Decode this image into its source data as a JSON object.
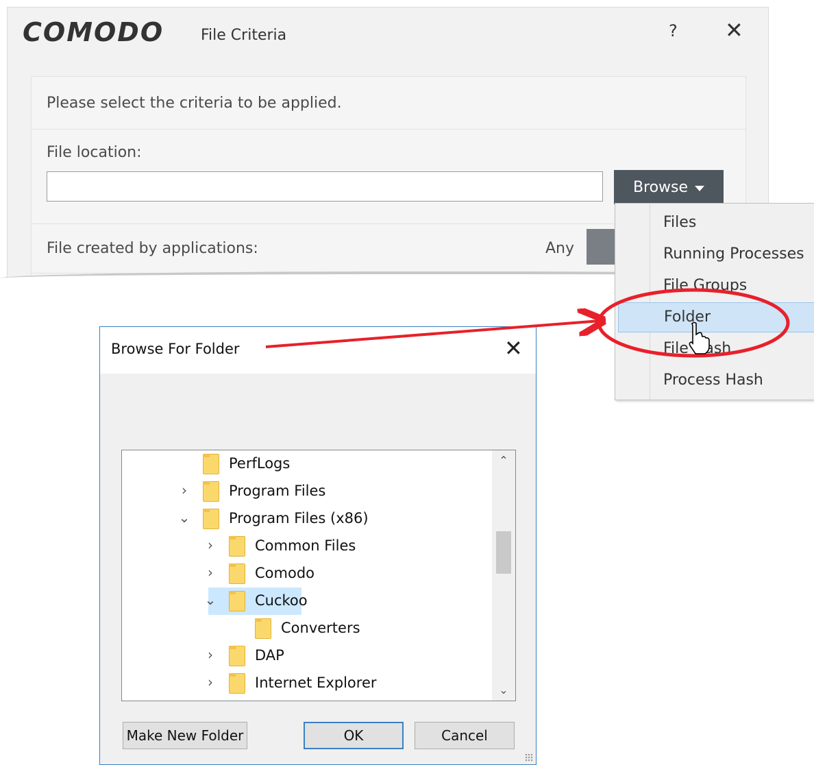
{
  "comodo": {
    "logo": "COMODO",
    "title": "File Criteria",
    "help": "?",
    "close": "✕",
    "instruction": "Please select the criteria to be applied.",
    "file_location_label": "File location:",
    "file_location_value": "",
    "browse_label": "Browse",
    "created_by_label": "File created by applications:",
    "created_by_value": "Any"
  },
  "browse_menu": {
    "items": [
      {
        "label": "Files"
      },
      {
        "label": "Running Processes"
      },
      {
        "label": "File Groups",
        "has_submenu": true
      },
      {
        "label": "Folder",
        "hovered": true
      },
      {
        "label": "File Hash"
      },
      {
        "label": "Process Hash"
      }
    ]
  },
  "annotation": {
    "color": "#e8202a"
  },
  "browse_for_folder": {
    "title": "Browse For Folder",
    "close": "✕",
    "tree": [
      {
        "label": "PerfLogs",
        "level": 0,
        "toggle": ""
      },
      {
        "label": "Program Files",
        "level": 0,
        "toggle": "›"
      },
      {
        "label": "Program Files (x86)",
        "level": 0,
        "toggle": "⌄"
      },
      {
        "label": "Common Files",
        "level": 1,
        "toggle": "›"
      },
      {
        "label": "Comodo",
        "level": 1,
        "toggle": "›"
      },
      {
        "label": "Cuckoo",
        "level": 1,
        "toggle": "⌄",
        "selected": true
      },
      {
        "label": "Converters",
        "level": 2,
        "toggle": ""
      },
      {
        "label": "DAP",
        "level": 1,
        "toggle": "›"
      },
      {
        "label": "Internet Explorer",
        "level": 1,
        "toggle": "›"
      }
    ],
    "buttons": {
      "new_folder": "Make New Folder",
      "ok": "OK",
      "cancel": "Cancel"
    }
  }
}
